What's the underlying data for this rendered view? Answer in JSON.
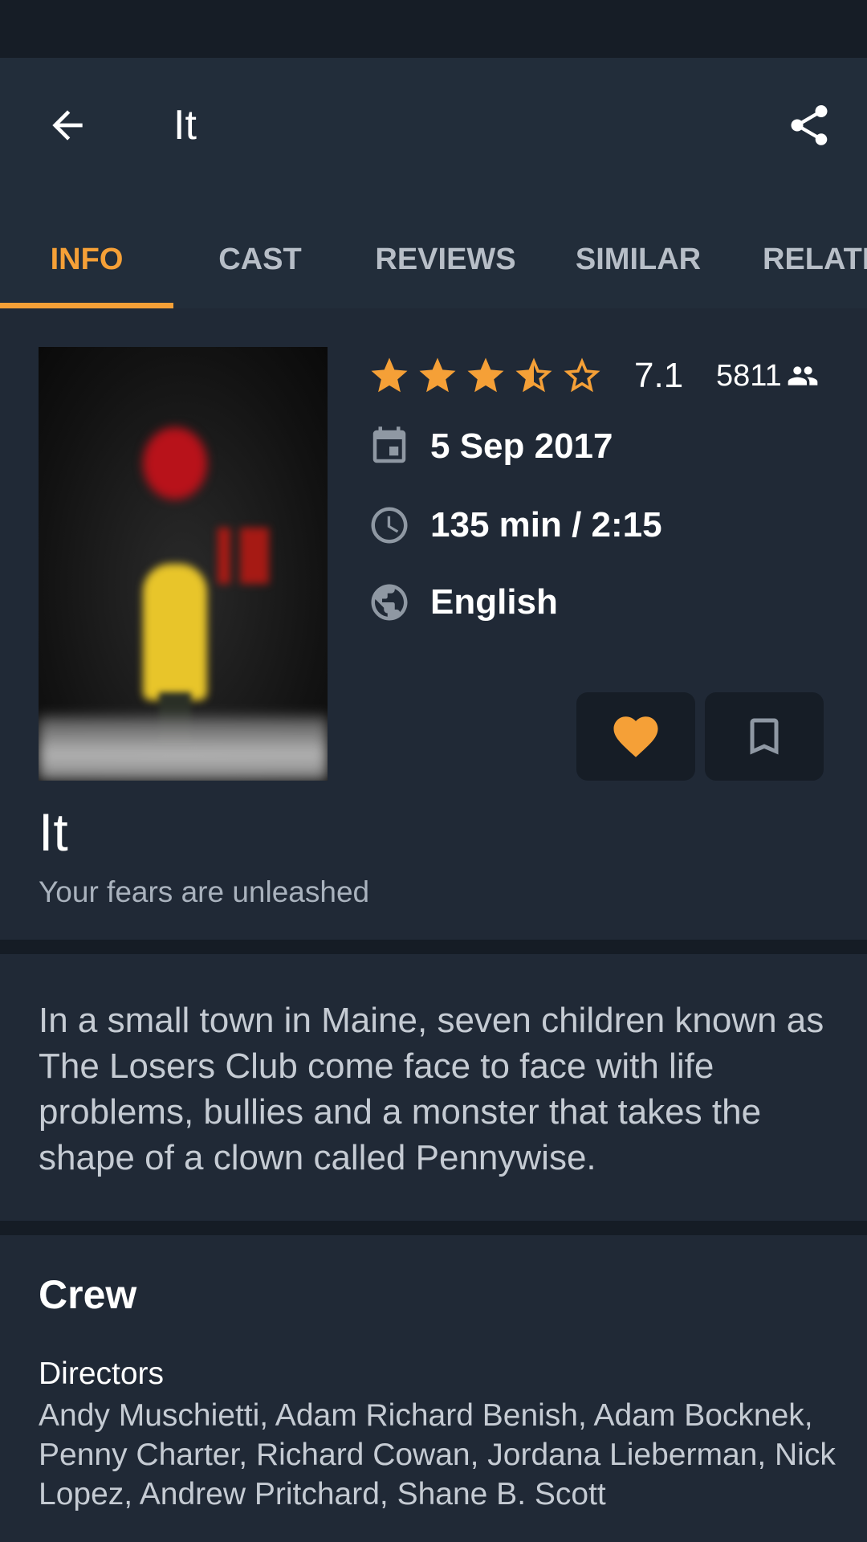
{
  "app_bar": {
    "title": "It",
    "back_icon": "arrow-back-icon",
    "share_icon": "share-icon"
  },
  "tabs": [
    {
      "label": "INFO",
      "active": true
    },
    {
      "label": "CAST",
      "active": false
    },
    {
      "label": "REVIEWS",
      "active": false
    },
    {
      "label": "SIMILAR",
      "active": false
    },
    {
      "label": "RELATI",
      "active": false
    }
  ],
  "movie": {
    "rating_stars": 3.5,
    "rating_max": 5,
    "rating": "7.1",
    "vote_count": "5811",
    "release_date": "5 Sep 2017",
    "runtime": "135 min / 2:15",
    "language": "English",
    "title": "It",
    "tagline": "Your fears are unleashed",
    "overview": "In a small town in Maine, seven children known as The Losers Club come face to face with life problems, bullies and a monster that takes the shape of a clown called Pennywise."
  },
  "actions": {
    "favorite_icon": "heart-icon",
    "watchlist_icon": "bookmark-icon"
  },
  "crew": {
    "title": "Crew",
    "role": "Directors",
    "names": "Andy Muschietti, Adam Richard Benish, Adam Bocknek, Penny Charter, Richard Cowan, Jordana Lieberman, Nick Lopez, Andrew Pritchard, Shane B. Scott"
  },
  "colors": {
    "accent": "#f5a037",
    "background": "#1c2430",
    "card": "#202936",
    "app_bar": "#222d3a",
    "status_bar": "#161d26"
  }
}
